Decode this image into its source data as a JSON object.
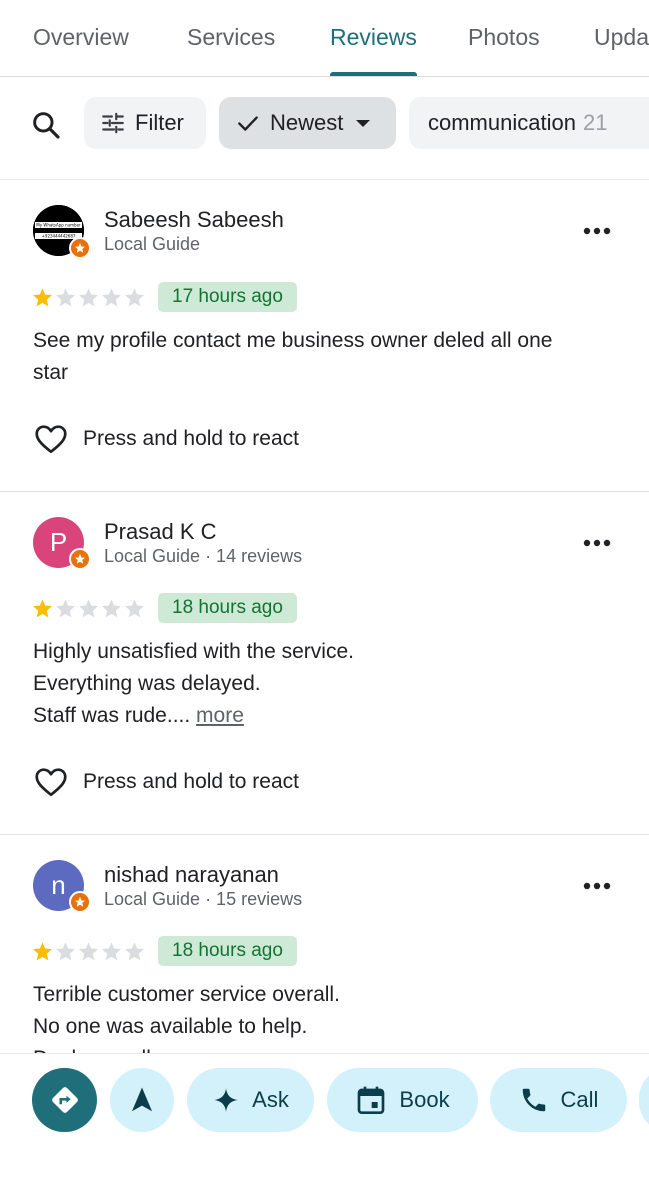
{
  "tabs": [
    {
      "label": "Overview",
      "active": false
    },
    {
      "label": "Services",
      "active": false
    },
    {
      "label": "Reviews",
      "active": true
    },
    {
      "label": "Photos",
      "active": false
    },
    {
      "label": "Upda",
      "active": false
    }
  ],
  "filters": {
    "search_icon": "search-icon",
    "filter_label": "Filter",
    "sort_label": "Newest",
    "topic_label": "communication",
    "topic_count": "21"
  },
  "reviews": [
    {
      "name": "Sabeesh Sabeesh",
      "meta": "Local Guide",
      "rating": 1,
      "time": "17 hours ago",
      "text_lines": [
        "See my profile contact me business owner deled all one",
        "star"
      ],
      "more": "",
      "react_label": "Press and hold to react",
      "avatar": {
        "type": "image",
        "caption_top": "My WhatsApp number",
        "caption_bottom": "+923444442687"
      }
    },
    {
      "name": "Prasad K C",
      "meta": "Local Guide · 14 reviews",
      "rating": 1,
      "time": "18 hours ago",
      "text_lines": [
        "Highly unsatisfied with the service.",
        "Everything was delayed.",
        "Staff was rude...."
      ],
      "more": "more",
      "react_label": "Press and hold to react",
      "avatar": {
        "type": "letter",
        "letter": "P",
        "color": "#d9457a"
      }
    },
    {
      "name": "nishad narayanan",
      "meta": "Local Guide · 15 reviews",
      "rating": 1,
      "time": "18 hours ago",
      "text_lines": [
        "Terrible customer service overall.",
        "No one was available to help.",
        "Dealers really"
      ],
      "more": "",
      "react_label": "Press and hold to react",
      "avatar": {
        "type": "letter",
        "letter": "n",
        "color": "#5c6bc0"
      }
    }
  ],
  "actions": {
    "ask_label": "Ask",
    "book_label": "Book",
    "call_label": "Call"
  },
  "colors": {
    "accent": "#1e6f7a",
    "star_filled": "#fbbc04",
    "star_empty": "#dadce0",
    "time_badge_bg": "#ceead6",
    "time_badge_text": "#137333",
    "action_bg": "#d3f1fb",
    "local_guide_badge": "#e8710a"
  }
}
